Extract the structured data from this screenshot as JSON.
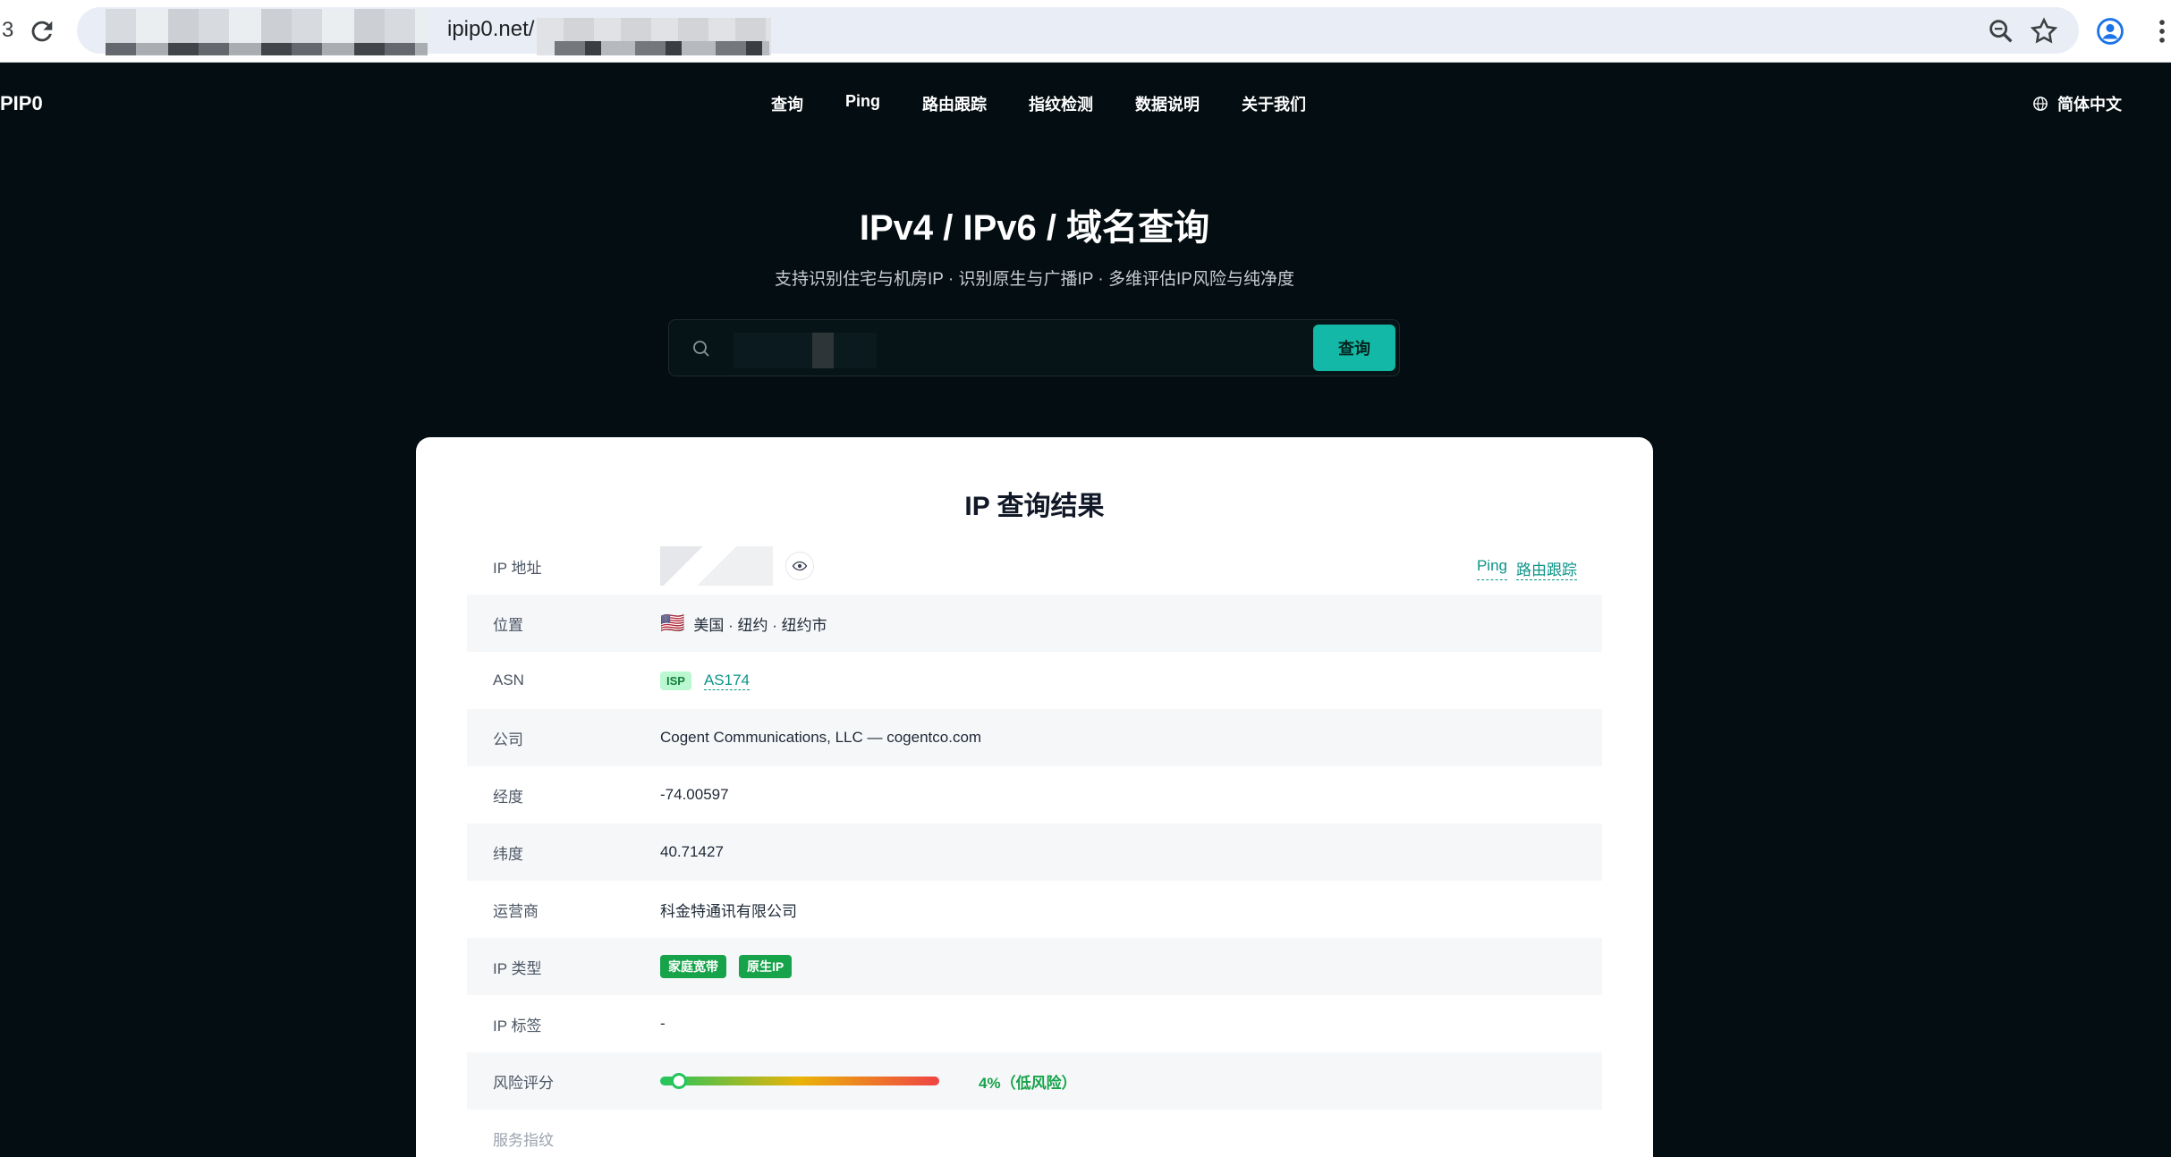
{
  "browser": {
    "tab_fragment": "3",
    "url": "ipip0.net/"
  },
  "site": {
    "logo": "PIP0",
    "nav": [
      "查询",
      "Ping",
      "路由跟踪",
      "指纹检测",
      "数据说明",
      "关于我们"
    ],
    "language": "简体中文"
  },
  "hero": {
    "title": "IPv4 / IPv6 / 域名查询",
    "subtitle": "支持识别住宅与机房IP · 识别原生与广播IP · 多维评估IP风险与纯净度",
    "search_value": "",
    "search_button": "查询"
  },
  "result": {
    "title": "IP 查询结果",
    "ip_label": "IP 地址",
    "ping_link": "Ping",
    "trace_link": "路由跟踪",
    "location_label": "位置",
    "location_flag": "🇺🇸",
    "location": "美国 · 纽约 · 纽约市",
    "asn_label": "ASN",
    "asn_badge": "ISP",
    "asn": "AS174",
    "company_label": "公司",
    "company": "Cogent Communications, LLC — cogentco.com",
    "longitude_label": "经度",
    "longitude": "-74.00597",
    "latitude_label": "纬度",
    "latitude": "40.71427",
    "carrier_label": "运营商",
    "carrier": "科金特通讯有限公司",
    "ip_type_label": "IP 类型",
    "ip_types": [
      "家庭宽带",
      "原生IP"
    ],
    "ip_tag_label": "IP 标签",
    "ip_tag": "-",
    "risk_label": "风险评分",
    "risk_percent": 4,
    "risk_text": "4%（低风险）",
    "next_label": "服务指纹"
  },
  "colors": {
    "page_bg": "#040d11",
    "accent": "#14b8a6",
    "link": "#0d9488",
    "badge_green": "#16a34a"
  }
}
